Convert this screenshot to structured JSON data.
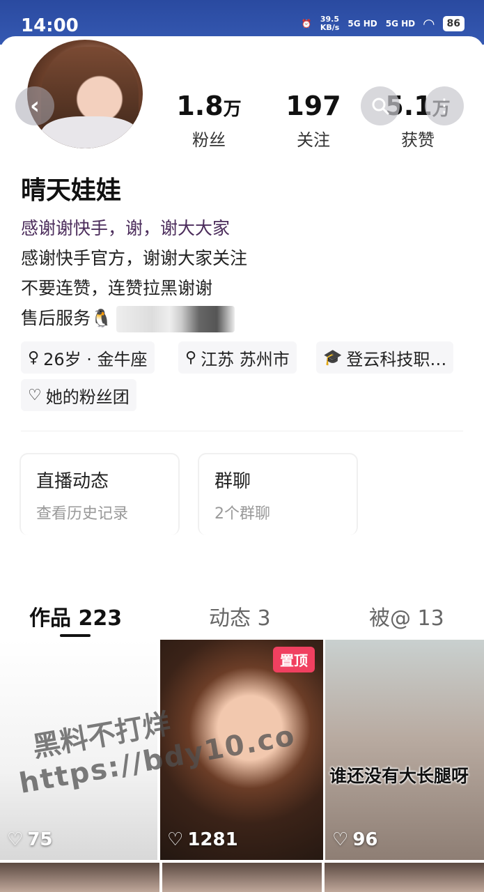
{
  "status_bar": {
    "time": "14:00",
    "net_speed": "39.5",
    "net_unit": "KB/s",
    "signal1": "5G HD",
    "signal2": "5G HD",
    "battery": "86"
  },
  "profile": {
    "nickname": "晴天娃娃",
    "stats": [
      {
        "value": "1.8",
        "unit": "万",
        "label": "粉丝"
      },
      {
        "value": "197",
        "unit": "",
        "label": "关注"
      },
      {
        "value": "5.1",
        "unit": "万",
        "label": "获赞"
      }
    ],
    "bio": {
      "line1": "感谢谢快手，谢，谢大大家",
      "line2": "感谢快手官方，谢谢大家关注",
      "line3": "不要连赞，连赞拉黑谢谢",
      "line4": "售后服务🐧"
    },
    "tags": {
      "age": "26岁 · 金牛座",
      "location": "江苏 苏州市",
      "school": "登云科技职…",
      "fan_group": "她的粉丝团"
    }
  },
  "features": [
    {
      "title": "直播动态",
      "subtitle": "查看历史记录"
    },
    {
      "title": "群聊",
      "subtitle": "2个群聊"
    }
  ],
  "tabs": [
    {
      "label": "作品 223"
    },
    {
      "label": "动态 3"
    },
    {
      "label": "被@ 13"
    }
  ],
  "videos": [
    {
      "likes": "75"
    },
    {
      "likes": "1281",
      "badge": "置顶"
    },
    {
      "likes": "96",
      "caption": "谁还没有大长腿呀"
    }
  ],
  "watermark": {
    "line1": "黑料不打烊",
    "line2": "https://bdy10.co"
  },
  "colors": {
    "status_bar": "#2f52a8",
    "pinned": "#f04060"
  }
}
